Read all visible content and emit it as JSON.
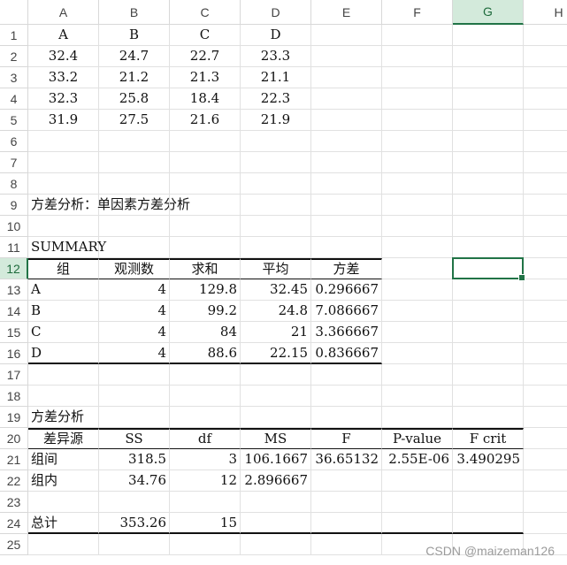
{
  "columns": [
    "A",
    "B",
    "C",
    "D",
    "E",
    "F",
    "G",
    "H"
  ],
  "rows": [
    "1",
    "2",
    "3",
    "4",
    "5",
    "6",
    "7",
    "8",
    "9",
    "10",
    "11",
    "12",
    "13",
    "14",
    "15",
    "16",
    "17",
    "18",
    "19",
    "20",
    "21",
    "22",
    "23",
    "24",
    "25"
  ],
  "active_cell": "G12",
  "cells": [
    {
      "ref": "A1",
      "text": "A",
      "align": "ctr"
    },
    {
      "ref": "B1",
      "text": "B",
      "align": "ctr"
    },
    {
      "ref": "C1",
      "text": "C",
      "align": "ctr"
    },
    {
      "ref": "D1",
      "text": "D",
      "align": "ctr"
    },
    {
      "ref": "A2",
      "text": "32.4",
      "align": "ctr"
    },
    {
      "ref": "B2",
      "text": "24.7",
      "align": "ctr"
    },
    {
      "ref": "C2",
      "text": "22.7",
      "align": "ctr"
    },
    {
      "ref": "D2",
      "text": "23.3",
      "align": "ctr"
    },
    {
      "ref": "A3",
      "text": "33.2",
      "align": "ctr"
    },
    {
      "ref": "B3",
      "text": "21.2",
      "align": "ctr"
    },
    {
      "ref": "C3",
      "text": "21.3",
      "align": "ctr"
    },
    {
      "ref": "D3",
      "text": "21.1",
      "align": "ctr"
    },
    {
      "ref": "A4",
      "text": "32.3",
      "align": "ctr"
    },
    {
      "ref": "B4",
      "text": "25.8",
      "align": "ctr"
    },
    {
      "ref": "C4",
      "text": "18.4",
      "align": "ctr"
    },
    {
      "ref": "D4",
      "text": "22.3",
      "align": "ctr"
    },
    {
      "ref": "A5",
      "text": "31.9",
      "align": "ctr"
    },
    {
      "ref": "B5",
      "text": "27.5",
      "align": "ctr"
    },
    {
      "ref": "C5",
      "text": "21.6",
      "align": "ctr"
    },
    {
      "ref": "D5",
      "text": "21.9",
      "align": "ctr"
    },
    {
      "ref": "A9",
      "text": "方差分析：单因素方差分析",
      "align": "lft"
    },
    {
      "ref": "A11",
      "text": "SUMMARY",
      "align": "lft"
    },
    {
      "ref": "A12",
      "text": "组",
      "align": "ctr",
      "style": "top2 bot1"
    },
    {
      "ref": "B12",
      "text": "观测数",
      "align": "ctr",
      "style": "top2 bot1"
    },
    {
      "ref": "C12",
      "text": "求和",
      "align": "ctr",
      "style": "top2 bot1"
    },
    {
      "ref": "D12",
      "text": "平均",
      "align": "ctr",
      "style": "top2 bot1"
    },
    {
      "ref": "E12",
      "text": "方差",
      "align": "ctr",
      "style": "top2 bot1"
    },
    {
      "ref": "A13",
      "text": "A",
      "align": "lft"
    },
    {
      "ref": "B13",
      "text": "4",
      "align": "num"
    },
    {
      "ref": "C13",
      "text": "129.8",
      "align": "num"
    },
    {
      "ref": "D13",
      "text": "32.45",
      "align": "num"
    },
    {
      "ref": "E13",
      "text": "0.296667",
      "align": "num"
    },
    {
      "ref": "A14",
      "text": "B",
      "align": "lft"
    },
    {
      "ref": "B14",
      "text": "4",
      "align": "num"
    },
    {
      "ref": "C14",
      "text": "99.2",
      "align": "num"
    },
    {
      "ref": "D14",
      "text": "24.8",
      "align": "num"
    },
    {
      "ref": "E14",
      "text": "7.086667",
      "align": "num"
    },
    {
      "ref": "A15",
      "text": "C",
      "align": "lft"
    },
    {
      "ref": "B15",
      "text": "4",
      "align": "num"
    },
    {
      "ref": "C15",
      "text": "84",
      "align": "num"
    },
    {
      "ref": "D15",
      "text": "21",
      "align": "num"
    },
    {
      "ref": "E15",
      "text": "3.366667",
      "align": "num"
    },
    {
      "ref": "A16",
      "text": "D",
      "align": "lft",
      "style": "bot2"
    },
    {
      "ref": "B16",
      "text": "4",
      "align": "num",
      "style": "bot2"
    },
    {
      "ref": "C16",
      "text": "88.6",
      "align": "num",
      "style": "bot2"
    },
    {
      "ref": "D16",
      "text": "22.15",
      "align": "num",
      "style": "bot2"
    },
    {
      "ref": "E16",
      "text": "0.836667",
      "align": "num",
      "style": "bot2"
    },
    {
      "ref": "A19",
      "text": "方差分析",
      "align": "lft"
    },
    {
      "ref": "A20",
      "text": "差异源",
      "align": "ctr",
      "style": "top2 bot1"
    },
    {
      "ref": "B20",
      "text": "SS",
      "align": "ctr",
      "style": "top2 bot1"
    },
    {
      "ref": "C20",
      "text": "df",
      "align": "ctr",
      "style": "top2 bot1"
    },
    {
      "ref": "D20",
      "text": "MS",
      "align": "ctr",
      "style": "top2 bot1"
    },
    {
      "ref": "E20",
      "text": "F",
      "align": "ctr",
      "style": "top2 bot1"
    },
    {
      "ref": "F20",
      "text": "P-value",
      "align": "ctr",
      "style": "top2 bot1"
    },
    {
      "ref": "G20",
      "text": "F crit",
      "align": "ctr",
      "style": "top2 bot1"
    },
    {
      "ref": "A21",
      "text": "组间",
      "align": "lft"
    },
    {
      "ref": "B21",
      "text": "318.5",
      "align": "num"
    },
    {
      "ref": "C21",
      "text": "3",
      "align": "num"
    },
    {
      "ref": "D21",
      "text": "106.1667",
      "align": "num"
    },
    {
      "ref": "E21",
      "text": "36.65132",
      "align": "num"
    },
    {
      "ref": "F21",
      "text": "2.55E-06",
      "align": "num"
    },
    {
      "ref": "G21",
      "text": "3.490295",
      "align": "num"
    },
    {
      "ref": "A22",
      "text": "组内",
      "align": "lft"
    },
    {
      "ref": "B22",
      "text": "34.76",
      "align": "num"
    },
    {
      "ref": "C22",
      "text": "12",
      "align": "num"
    },
    {
      "ref": "D22",
      "text": "2.896667",
      "align": "num"
    },
    {
      "ref": "A24",
      "text": "总计",
      "align": "lft",
      "style": "bot2"
    },
    {
      "ref": "B24",
      "text": "353.26",
      "align": "num",
      "style": "bot2"
    },
    {
      "ref": "C24",
      "text": "15",
      "align": "num",
      "style": "bot2"
    },
    {
      "ref": "D24",
      "text": "",
      "align": "num",
      "style": "bot2"
    },
    {
      "ref": "E24",
      "text": "",
      "align": "num",
      "style": "bot2"
    },
    {
      "ref": "F24",
      "text": "",
      "align": "num",
      "style": "bot2"
    },
    {
      "ref": "G24",
      "text": "",
      "align": "num",
      "style": "bot2"
    }
  ],
  "watermark": "CSDN @maizeman126",
  "colors": {
    "accent": "#217346",
    "active_header_bg": "#d3eadb"
  }
}
